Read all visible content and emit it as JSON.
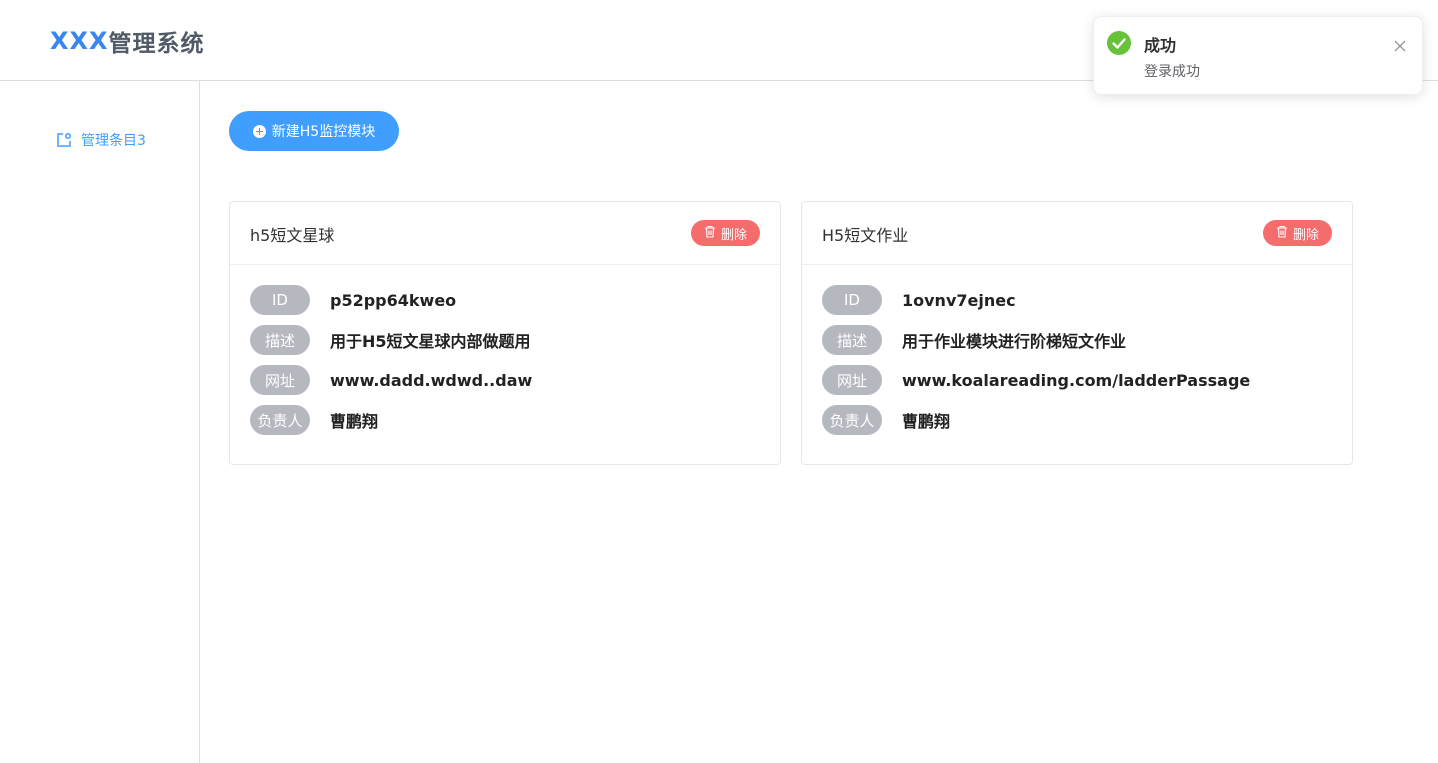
{
  "header": {
    "logo_prefix": "XXX",
    "logo_text": "管理系统"
  },
  "sidebar": {
    "items": [
      {
        "label": "管理条目3",
        "icon": "external-window-icon",
        "active": true
      }
    ]
  },
  "main": {
    "new_button_label": "新建H5监控模块",
    "cards": [
      {
        "title": "h5短文星球",
        "delete_label": "删除",
        "fields": [
          {
            "label": "ID",
            "value": "p52pp64kweo"
          },
          {
            "label": "描述",
            "value": "用于H5短文星球内部做题用"
          },
          {
            "label": "网址",
            "value": "www.dadd.wdwd..daw"
          },
          {
            "label": "负责人",
            "value": "曹鹏翔"
          }
        ]
      },
      {
        "title": "H5短文作业",
        "delete_label": "删除",
        "fields": [
          {
            "label": "ID",
            "value": "1ovnv7ejnec"
          },
          {
            "label": "描述",
            "value": "用于作业模块进行阶梯短文作业"
          },
          {
            "label": "网址",
            "value": "www.koalareading.com/ladderPassage"
          },
          {
            "label": "负责人",
            "value": "曹鹏翔"
          }
        ]
      }
    ]
  },
  "notification": {
    "title": "成功",
    "message": "登录成功",
    "type": "success"
  },
  "colors": {
    "primary": "#409eff",
    "danger": "#f56c6c",
    "success": "#67c23a",
    "tag": "#b5b8bf"
  }
}
